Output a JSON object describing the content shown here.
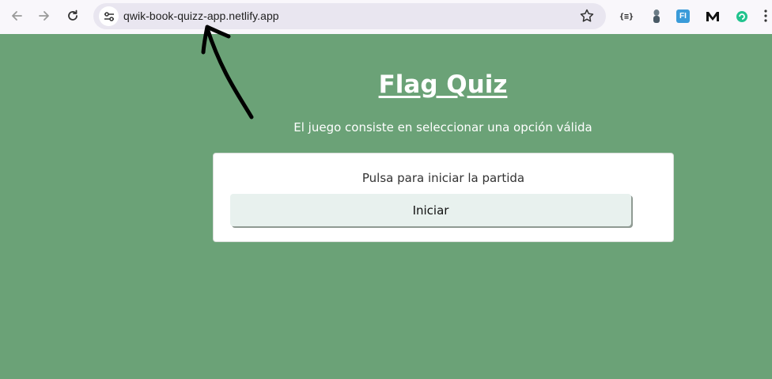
{
  "browser": {
    "url": "qwik-book-quizz-app.netlify.app",
    "icons": [
      "back-arrow-icon",
      "forward-arrow-icon",
      "reload-icon",
      "site-info-icon",
      "bookmark-star-icon"
    ],
    "extensions": {
      "json": "{≡}",
      "fi": "FI"
    }
  },
  "page": {
    "title": "Flag Quiz",
    "subtitle": "El juego consiste en seleccionar una opción válida",
    "card": {
      "prompt": "Pulsa para iniciar la partida",
      "start_label": "Iniciar"
    }
  },
  "colors": {
    "background": "#6ba277",
    "card": "#ffffff",
    "button": "#e8f1ee",
    "toolbar": "#f9f7fb",
    "omnibox": "#e9e6f0"
  }
}
